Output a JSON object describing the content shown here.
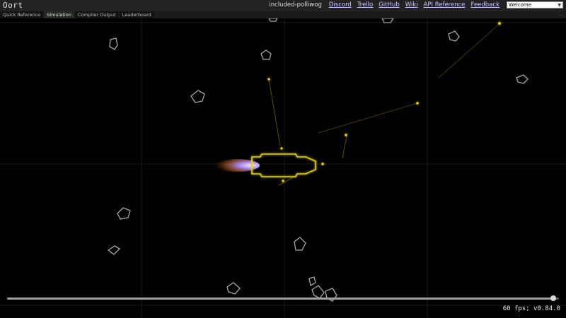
{
  "app": {
    "title": "Oort"
  },
  "header": {
    "username": "included-polliwog",
    "links": [
      "Discord",
      "Trello",
      "GitHub",
      "Wiki",
      "API Reference",
      "Feedback"
    ],
    "scenario_select": {
      "selected": "Welcome"
    }
  },
  "tabs": [
    {
      "label": "Quick Reference",
      "active": false
    },
    {
      "label": "Simulation",
      "active": true
    },
    {
      "label": "Compiler Output",
      "active": false
    },
    {
      "label": "Leaderboard",
      "active": false
    }
  ],
  "tab_menu_icon": "ellipsis-icon",
  "simulation": {
    "colors": {
      "background": "#000000",
      "grid": "#1e1e1e",
      "asteroid": "#a8a8a8",
      "ship": "#e6d300",
      "bullet": "#ffe000",
      "exhaust": "#b48cff"
    },
    "playback_progress": 0.99
  },
  "status": {
    "text": "60 fps; v0.84.0"
  }
}
